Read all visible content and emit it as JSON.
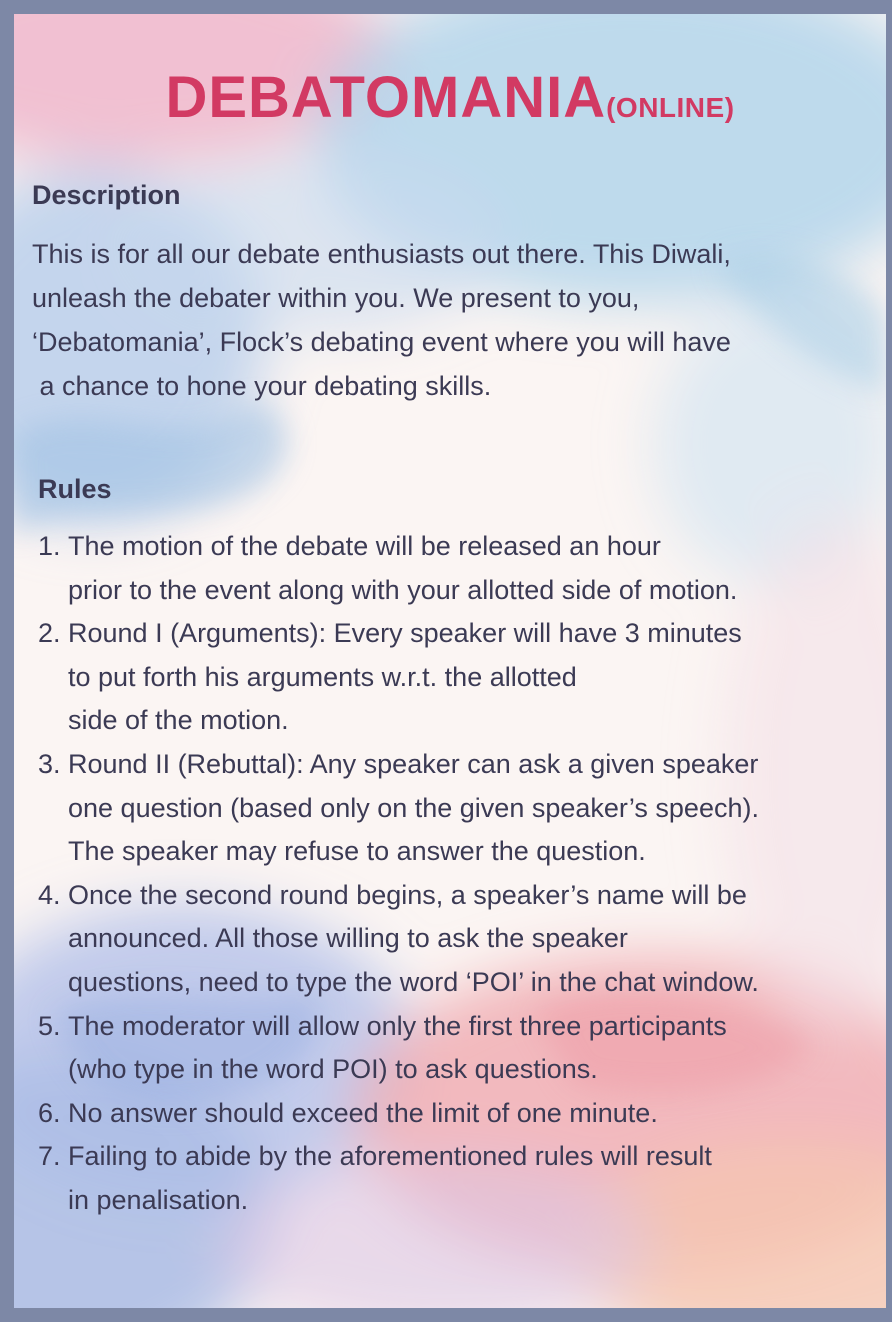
{
  "title": {
    "main": "DEBATOMANIA",
    "sub": "(ONLINE)"
  },
  "description": {
    "heading": "Description",
    "lines": [
      "This is for all our debate enthusiasts out there. This Diwali,",
      "unleash the debater within you. We present to you,",
      "‘Debatomania’, Flock’s debating event where you will have",
      " a chance to hone your debating skills."
    ]
  },
  "rules": {
    "heading": "Rules",
    "items": [
      {
        "num": "1.",
        "lines": [
          "The motion of the debate will be released an hour",
          "prior to the event along with your allotted side of motion."
        ]
      },
      {
        "num": "2.",
        "lines": [
          "Round I (Arguments): Every speaker will have 3 minutes",
          "to put forth his arguments w.r.t. the allotted",
          "side of the motion."
        ]
      },
      {
        "num": "3.",
        "lines": [
          "Round II (Rebuttal): Any speaker can ask a given speaker",
          "one question (based only on the given speaker’s speech).",
          "The speaker may refuse to answer the question."
        ]
      },
      {
        "num": "4.",
        "lines": [
          "Once the second round begins, a speaker’s name will be",
          "announced. All those willing to ask the speaker",
          "questions, need to type the word ‘POI’ in the chat window."
        ]
      },
      {
        "num": "5.",
        "lines": [
          "The moderator will allow only the first three participants",
          "(who type in the word POI) to ask questions."
        ]
      },
      {
        "num": "6.",
        "lines": [
          "No answer should exceed the limit of one minute."
        ]
      },
      {
        "num": "7.",
        "lines": [
          "Failing to abide by the aforementioned rules will result",
          "in penalisation."
        ]
      }
    ]
  },
  "colors": {
    "border": "#7d88a6",
    "title": "#d23a63",
    "text": "#3b3a54",
    "wash_blue": "#a9c6e6",
    "wash_pink": "#f0b9c6",
    "wash_peach": "#f3c3b6"
  }
}
